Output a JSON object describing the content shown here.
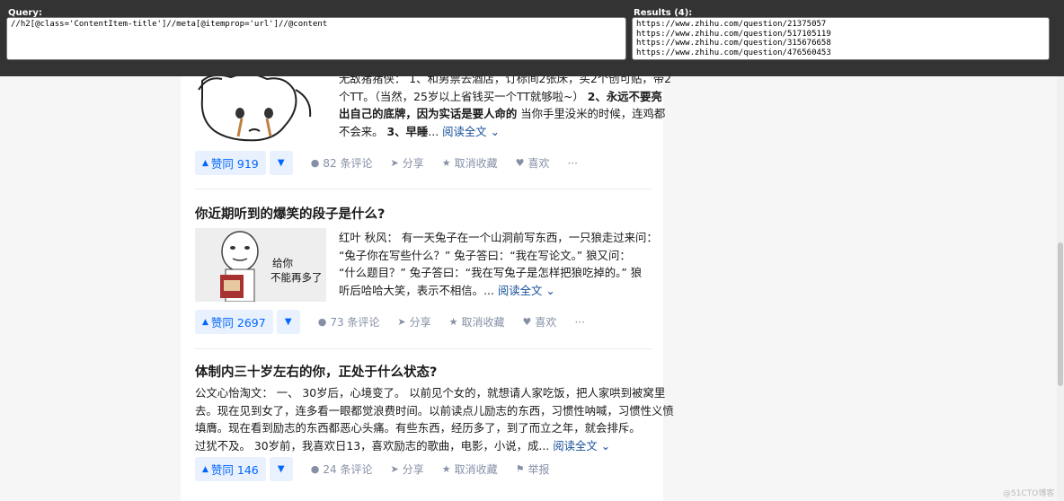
{
  "xpath": {
    "query_label": "Query:",
    "query": "//h2[@class='ContentItem-title']//meta[@itemprop='url']//@content",
    "results_label": "Results (4):",
    "results": [
      "https://www.zhihu.com/question/21375057",
      "https://www.zhihu.com/question/517105119",
      "https://www.zhihu.com/question/315676658",
      "https://www.zhihu.com/question/476560453"
    ]
  },
  "items": [
    {
      "excerpt_html_lines": [
        "无敌猪猪侠： 1、和男票去酒店，订标间2张床，买2个创可贴，带2",
        "个TT。（当然，25岁以上省钱买一个TT就够啦~） 2、永远不要亮",
        "出自己的底牌，因为实话是要人命的 当你手里没米的时候，连鸡都",
        "不会来。 3、早睡..."
      ],
      "read_more": "阅读全文",
      "vote_up": "赞同 919",
      "comments": "82 条评论",
      "share": "分享",
      "favorite": "取消收藏",
      "like": "喜欢"
    },
    {
      "title": "你近期听到的爆笑的段子是什么?",
      "image_caption_1": "给你",
      "image_caption_2": "不能再多了",
      "excerpt_lines": [
        "红叶 秋风： 有一天兔子在一个山洞前写东西，一只狼走过来问：",
        "“兔子你在写些什么？” 兔子答曰：“我在写论文。” 狼又问：",
        "“什么题目？” 兔子答曰：“我在写兔子是怎样把狼吃掉的。” 狼",
        "听后哈哈大笑，表示不相信。..."
      ],
      "read_more": "阅读全文",
      "vote_up": "赞同 2697",
      "comments": "73 条评论",
      "share": "分享",
      "favorite": "取消收藏",
      "like": "喜欢"
    },
    {
      "title": "体制内三十岁左右的你，正处于什么状态?",
      "excerpt_lines": [
        "公文心怡淘文： 一、 30岁后，心境变了。 以前见个女的，就想请人家吃饭，把人家哄到被窝里",
        "去。现在见到女了，连多看一眼都觉浪费时间。以前读点儿励志的东西，习惯性呐喊，习惯性义愤",
        "填膺。现在看到励志的东西都恶心头痛。有些东西，经历多了，到了而立之年，就会排斥。",
        "过犹不及。 30岁前，我喜欢日13，喜欢励志的歌曲，电影，小说，成..."
      ],
      "read_more": "阅读全文",
      "vote_up": "赞同 146",
      "comments": "24 条评论",
      "share": "分享",
      "favorite": "取消收藏",
      "report": "举报"
    }
  ],
  "more": "···",
  "watermark": "@51CTO博客"
}
